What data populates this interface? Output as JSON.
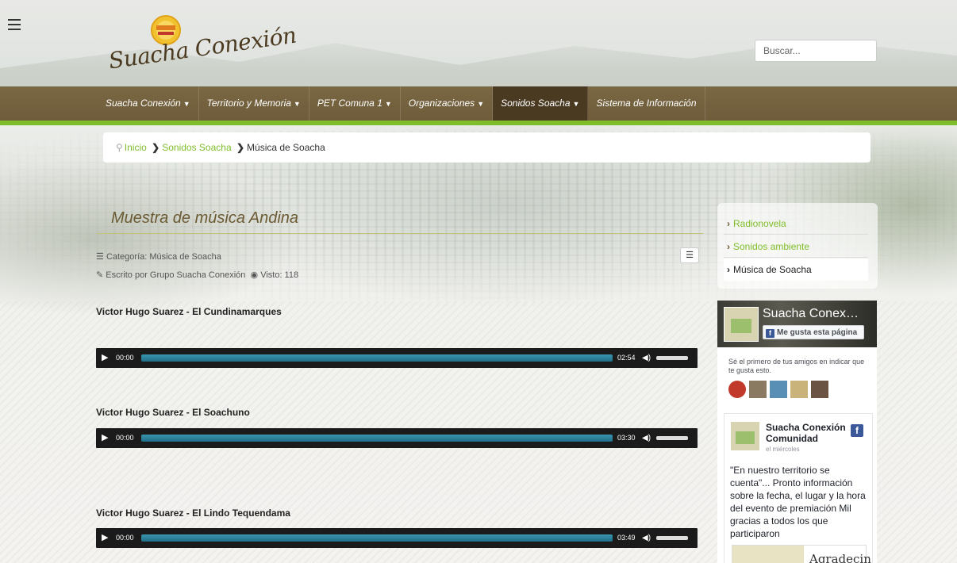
{
  "header": {
    "logo_text": "Suacha Conexión",
    "search_placeholder": "Buscar..."
  },
  "nav": {
    "items": [
      {
        "label": "Suacha Conexión",
        "has_caret": true
      },
      {
        "label": "Territorio y Memoria",
        "has_caret": true
      },
      {
        "label": "PET Comuna 1",
        "has_caret": true
      },
      {
        "label": "Organizaciones",
        "has_caret": true
      },
      {
        "label": "Sonidos Soacha",
        "has_caret": true,
        "active": true
      },
      {
        "label": "Sistema de Información",
        "has_caret": false
      }
    ]
  },
  "breadcrumb": {
    "home": "Inicio",
    "section": "Sonidos Soacha",
    "current": "Música de Soacha"
  },
  "article": {
    "title": "Muestra de música Andina",
    "category": "Categoría: Música de Soacha",
    "author": "Escrito por Grupo Suacha Conexión",
    "views": "Visto: 118",
    "songs": [
      {
        "title": "Victor Hugo Suarez - El Cundinamarques",
        "current": "00:00",
        "duration": "02:54"
      },
      {
        "title": "Victor Hugo Suarez - El Soachuno",
        "current": "00:00",
        "duration": "03:30"
      },
      {
        "title": "Victor Hugo Suarez - El Lindo Tequendama",
        "current": "00:00",
        "duration": "03:49"
      }
    ]
  },
  "sidebar": {
    "items": [
      {
        "label": "Radionovela"
      },
      {
        "label": "Sonidos ambiente"
      },
      {
        "label": "Música de Soacha",
        "active": true
      }
    ]
  },
  "facebook": {
    "page_name": "Suacha Conex…",
    "like_label": "Me gusta esta página",
    "friends_text": "Sé el primero de tus amigos en indicar que te gusta esto.",
    "post": {
      "author": "Suacha Conexión Comunidad",
      "date": "el miércoles",
      "text": "\"En nuestro territorio se cuenta\"... Pronto información sobre la fecha, el lugar y la hora del evento de premiación Mil gracias a todos los que participaron",
      "image_word": "Agradecin"
    }
  },
  "colors": {
    "nav_bg": "#6e5c3a",
    "accent_green": "#7fbd2a",
    "title_brown": "#6b5a32",
    "player_track": "#1f6d87",
    "facebook_blue": "#3b5998"
  },
  "icons": {
    "menu": "hamburger-icon",
    "breadcrumb_home": "map-pin-icon",
    "category": "list-icon",
    "author": "pencil-icon",
    "views": "eye-icon",
    "player_play": "play-icon",
    "player_volume": "volume-icon",
    "sidebar_chevron": "chevron-right-icon"
  }
}
